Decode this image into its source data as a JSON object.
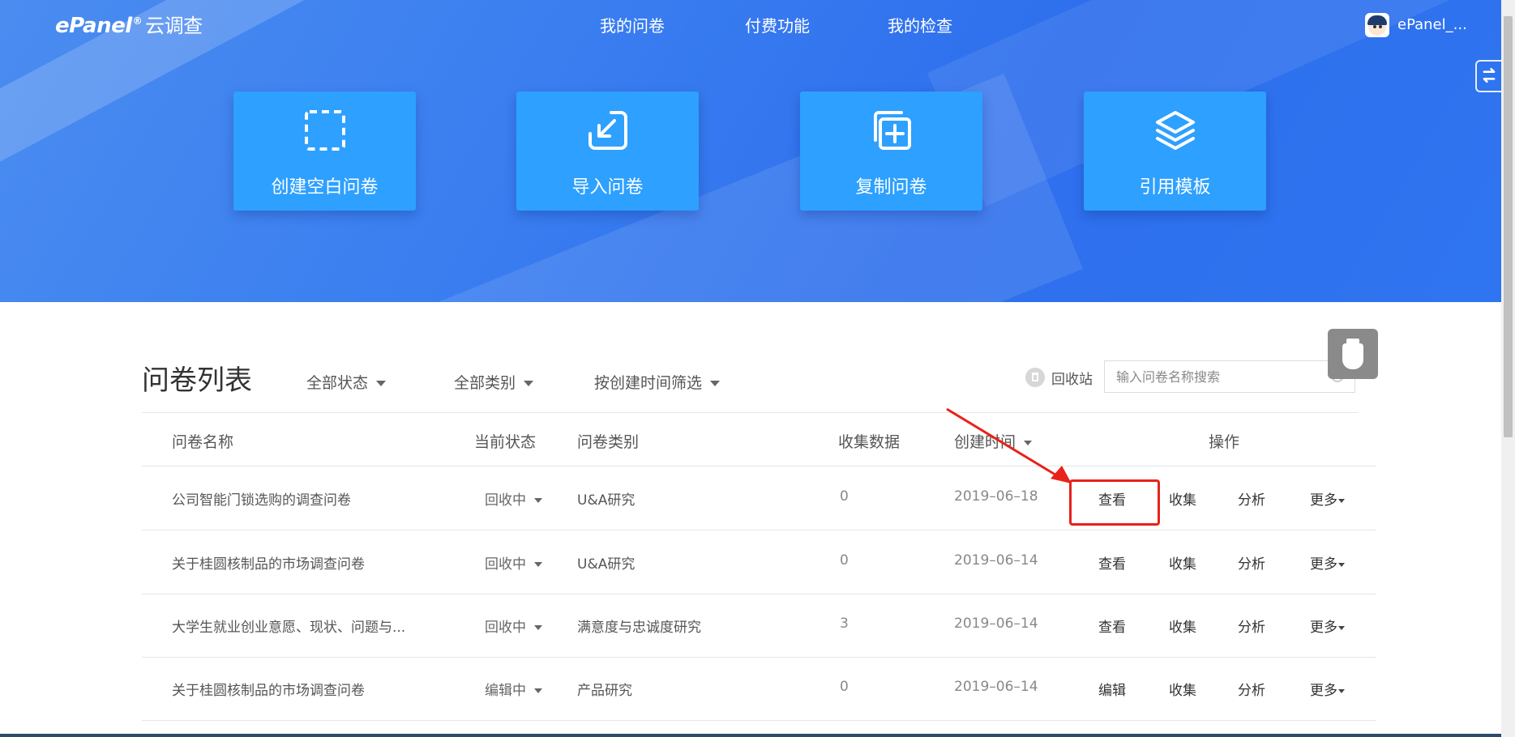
{
  "header": {
    "logo_brand": "ePanel",
    "logo_reg": "®",
    "logo_cn": "云调查",
    "nav": [
      "我的问卷",
      "付费功能",
      "我的检查"
    ],
    "user_name": "ePanel_..."
  },
  "actions": [
    {
      "label": "创建空白问卷",
      "icon": "dashed-square-icon"
    },
    {
      "label": "导入问卷",
      "icon": "import-arrow-icon"
    },
    {
      "label": "复制问卷",
      "icon": "copy-plus-icon"
    },
    {
      "label": "引用模板",
      "icon": "layers-icon"
    }
  ],
  "list": {
    "title": "问卷列表",
    "filters": [
      "全部状态",
      "全部类别",
      "按创建时间筛选"
    ],
    "recycle_label": "回收站",
    "search_placeholder": "输入问卷名称搜索",
    "columns": {
      "name": "问卷名称",
      "status": "当前状态",
      "category": "问卷类别",
      "count": "收集数据",
      "created": "创建时间",
      "ops": "操作"
    },
    "rows": [
      {
        "name": "公司智能门锁选购的调查问卷",
        "status": "回收中",
        "category": "U&A研究",
        "count": "0",
        "date": "2019–06–18",
        "op1": "查看",
        "op2": "收集",
        "op3": "分析",
        "op4": "更多"
      },
      {
        "name": "关于桂圆核制品的市场调查问卷",
        "status": "回收中",
        "category": "U&A研究",
        "count": "0",
        "date": "2019–06–14",
        "op1": "查看",
        "op2": "收集",
        "op3": "分析",
        "op4": "更多"
      },
      {
        "name": "大学生就业创业意愿、现状、问题与...",
        "status": "回收中",
        "category": "满意度与忠诚度研究",
        "count": "3",
        "date": "2019–06–14",
        "op1": "查看",
        "op2": "收集",
        "op3": "分析",
        "op4": "更多"
      },
      {
        "name": "关于桂圆核制品的市场调查问卷",
        "status": "编辑中",
        "category": "产品研究",
        "count": "0",
        "date": "2019–06–14",
        "op1": "编辑",
        "op2": "收集",
        "op3": "分析",
        "op4": "更多"
      }
    ]
  },
  "colors": {
    "hero_blue": "#2f74f0",
    "card_blue": "#2ea0ff",
    "annotation_red": "#e8221a"
  }
}
